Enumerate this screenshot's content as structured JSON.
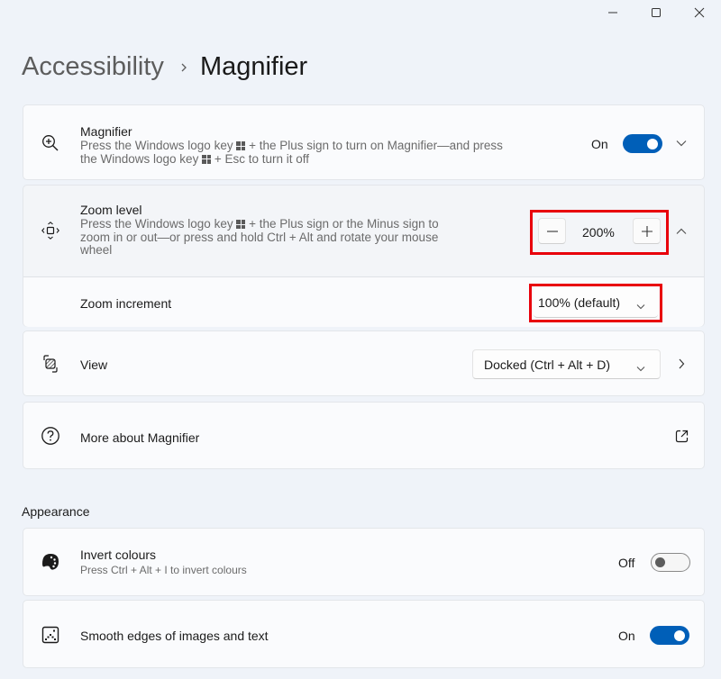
{
  "window": {
    "controls": [
      {
        "name": "minimize",
        "icon": "minimize-icon"
      },
      {
        "name": "maximize",
        "icon": "maximize-icon"
      },
      {
        "name": "close",
        "icon": "close-icon"
      }
    ]
  },
  "breadcrumb": {
    "parent": "Accessibility",
    "separator_icon": "chevron-right-icon",
    "current": "Magnifier"
  },
  "magnifier": {
    "icon": "zoom-in-icon",
    "title": "Magnifier",
    "desc_line1_a": "Press the Windows logo key",
    "desc_line1_b": "+ the Plus sign to turn on Magnifier—and press",
    "desc_line2_a": "the Windows logo key",
    "desc_line2_b": "+ Esc to turn it off",
    "toggle_label": "On",
    "toggle_state": true,
    "expand_icon": "chevron-down-icon"
  },
  "zoom_level": {
    "icon": "move-arrows-icon",
    "title": "Zoom level",
    "desc_line1_a": "Press the Windows logo key",
    "desc_line1_b": "+ the Plus sign or the Minus sign to",
    "desc_line2": "zoom in or out—or press and hold Ctrl + Alt and rotate your mouse",
    "desc_line3": "wheel",
    "value": "200%",
    "decrease_icon": "minus-icon",
    "increase_icon": "plus-icon",
    "collapse_icon": "chevron-up-icon"
  },
  "zoom_increment": {
    "title": "Zoom increment",
    "selected": "100% (default)"
  },
  "view": {
    "icon": "view-layers-icon",
    "title": "View",
    "selected": "Docked (Ctrl + Alt + D)",
    "nav_icon": "chevron-right-icon"
  },
  "more_about": {
    "icon": "help-circle-icon",
    "title": "More about Magnifier",
    "link_icon": "open-external-icon"
  },
  "appearance": {
    "section_title": "Appearance",
    "invert": {
      "icon": "palette-icon",
      "title": "Invert colours",
      "desc": "Press Ctrl + Alt + I to invert colours",
      "toggle_label": "Off",
      "toggle_state": false
    },
    "smooth": {
      "icon": "smooth-edges-icon",
      "title": "Smooth edges of images and text",
      "toggle_label": "On",
      "toggle_state": true
    }
  },
  "colors": {
    "accent": "#005fb8",
    "highlight": "#e8000b",
    "background": "#eff3f9",
    "card": "#fafbfd"
  }
}
